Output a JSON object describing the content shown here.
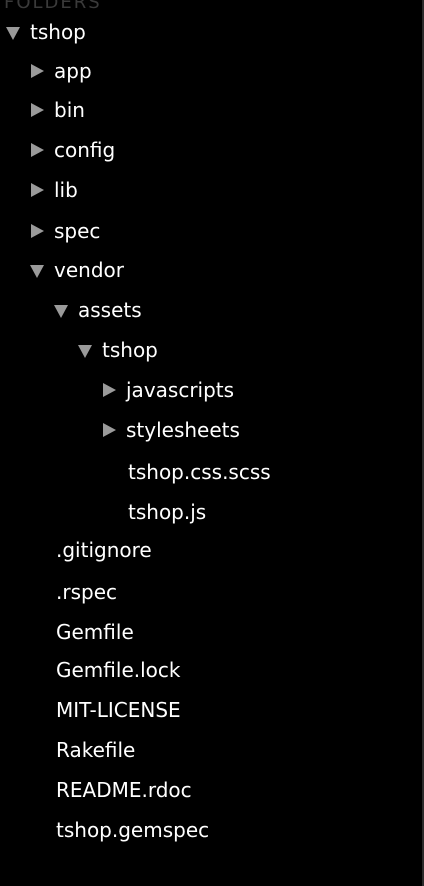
{
  "sidebar": {
    "header": "FOLDERS",
    "items": [
      {
        "label": "tshop",
        "state": "expanded"
      },
      {
        "label": "app",
        "state": "collapsed"
      },
      {
        "label": "bin",
        "state": "collapsed"
      },
      {
        "label": "config",
        "state": "collapsed"
      },
      {
        "label": "lib",
        "state": "collapsed"
      },
      {
        "label": "spec",
        "state": "collapsed"
      },
      {
        "label": "vendor",
        "state": "expanded"
      },
      {
        "label": "assets",
        "state": "expanded"
      },
      {
        "label": "tshop",
        "state": "expanded"
      },
      {
        "label": "javascripts",
        "state": "collapsed"
      },
      {
        "label": "stylesheets",
        "state": "collapsed"
      },
      {
        "label": "tshop.css.scss",
        "state": "file"
      },
      {
        "label": "tshop.js",
        "state": "file"
      },
      {
        "label": ".gitignore",
        "state": "file"
      },
      {
        "label": ".rspec",
        "state": "file"
      },
      {
        "label": "Gemfile",
        "state": "file"
      },
      {
        "label": "Gemfile.lock",
        "state": "file"
      },
      {
        "label": "MIT-LICENSE",
        "state": "file"
      },
      {
        "label": "Rakefile",
        "state": "file"
      },
      {
        "label": "README.rdoc",
        "state": "file"
      },
      {
        "label": "tshop.gemspec",
        "state": "file"
      }
    ]
  },
  "colors": {
    "background": "#000000",
    "text": "#ffffff",
    "arrow": "#9a9a9a"
  },
  "icons": {
    "expanded": "disclosure-triangle-down-icon",
    "collapsed": "disclosure-triangle-right-icon"
  }
}
